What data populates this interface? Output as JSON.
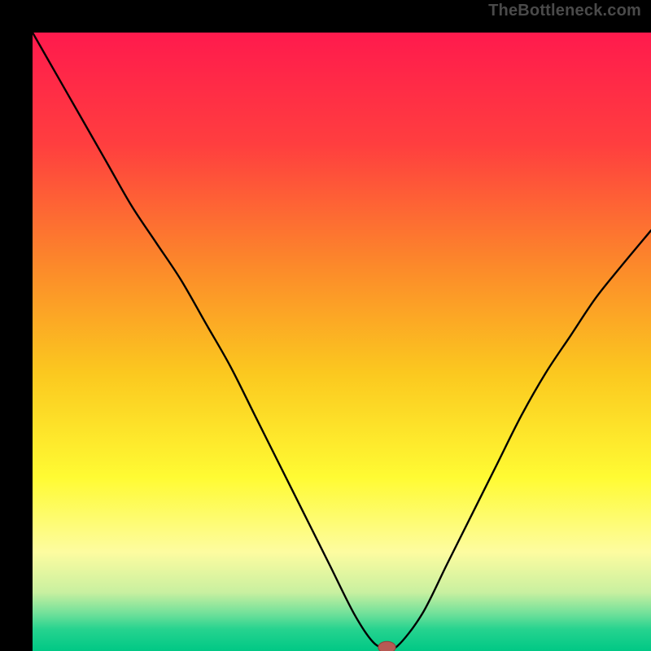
{
  "attribution": "TheBottleneck.com",
  "colors": {
    "black": "#000000",
    "curve": "#000000",
    "marker_fill": "#b85a54",
    "marker_stroke": "#8e423d"
  },
  "chart_data": {
    "type": "line",
    "title": "",
    "xlabel": "",
    "ylabel": "",
    "xlim": [
      0,
      100
    ],
    "ylim": [
      0,
      100
    ],
    "grid": false,
    "legend": false,
    "gradient": {
      "direction": "vertical",
      "stops": [
        {
          "offset": 0.0,
          "color": "#ff1a4d"
        },
        {
          "offset": 0.18,
          "color": "#ff3e3f"
        },
        {
          "offset": 0.38,
          "color": "#fc8a2a"
        },
        {
          "offset": 0.55,
          "color": "#fbc81f"
        },
        {
          "offset": 0.72,
          "color": "#fffb33"
        },
        {
          "offset": 0.84,
          "color": "#fdfca0"
        },
        {
          "offset": 0.905,
          "color": "#c9f0a0"
        },
        {
          "offset": 0.94,
          "color": "#6fe09a"
        },
        {
          "offset": 0.965,
          "color": "#26d38f"
        },
        {
          "offset": 1.0,
          "color": "#00c885"
        }
      ]
    },
    "series": [
      {
        "name": "bottleneck-curve",
        "x": [
          0,
          4,
          8,
          12,
          16,
          20,
          24,
          28,
          32,
          36,
          40,
          44,
          48,
          52,
          55,
          57,
          59,
          63,
          67,
          71,
          75,
          79,
          83,
          87,
          91,
          95,
          100
        ],
        "y": [
          100,
          93,
          86,
          79,
          72,
          66,
          60,
          53,
          46,
          38,
          30,
          22,
          14,
          6,
          1.5,
          0.5,
          0.8,
          6,
          14,
          22,
          30,
          38,
          45,
          51,
          57,
          62,
          68
        ]
      }
    ],
    "marker": {
      "x": 57.3,
      "y": 0.6,
      "rx": 1.4,
      "ry": 0.95
    }
  }
}
